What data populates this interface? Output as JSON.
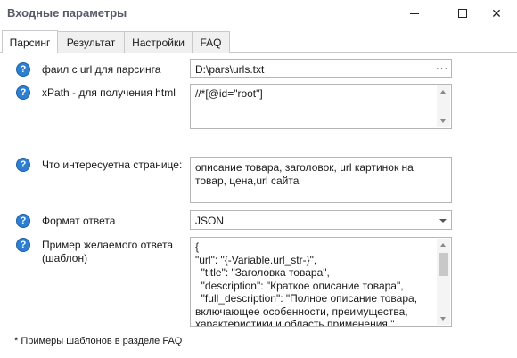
{
  "window": {
    "title": "Входные параметры",
    "controls": {
      "minimize_icon": "minimize-icon",
      "maximize_icon": "maximize-icon",
      "close_icon": "close-icon",
      "close_glyph": "✕"
    }
  },
  "tabs": [
    {
      "label": "Парсинг",
      "active": true
    },
    {
      "label": "Результат",
      "active": false
    },
    {
      "label": "Настройки",
      "active": false
    },
    {
      "label": "FAQ",
      "active": false
    }
  ],
  "help_glyph": "?",
  "params": {
    "file": {
      "label": "фаил с url для парсинга",
      "value": "D:\\pars\\urls.txt",
      "browse_label": "···"
    },
    "xpath": {
      "label": "xPath - для получения html",
      "value": "//*[@id=\"root\"]"
    },
    "interest": {
      "label": "Что интересуетна странице:",
      "value": "описание товара, заголовок, url картинок на товар, цена,url сайта"
    },
    "format": {
      "label": "Формат ответа",
      "value": "JSON"
    },
    "example": {
      "label_line1": "Пример желаемого ответа",
      "label_line2": "(шаблон)",
      "value": "{\n\"url\": \"{-Variable.url_str-}\",\n  \"title\": \"Заголовка товара\",\n  \"description\": \"Краткое описание товара\",\n  \"full_description\": \"Полное описание товара, включающее особенности, преимущества, характеристики и область применения.\",\n  \"images\": ["
    }
  },
  "footnote": "* Примеры шаблонов в разделе FAQ",
  "colors": {
    "help_icon": "#2f7fd0",
    "border": "#b5b5b5",
    "title_text": "#555a66"
  }
}
